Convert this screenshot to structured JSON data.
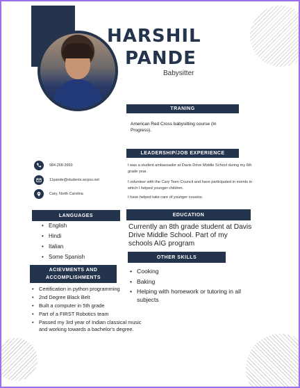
{
  "header": {
    "first_name": "HARSHIL",
    "last_name": "PANDE",
    "role": "Babysitter"
  },
  "training": {
    "title": "TRANING",
    "text": "American Red Cross babysitting course (In Progress)."
  },
  "experience": {
    "title": "LEADERSHIP/JOB EXPERIENCE",
    "items": [
      "I was a student ambassador at Davis Drive Middle School during my 6th grade year.",
      "I volunteer with the Cary Teen Council and have participated in events in which I helped younger children.",
      "I have helped take care of younger cousins."
    ]
  },
  "contact": {
    "phone": "984-268-3993",
    "email": "11pande@students.wcpss.net",
    "location": "Cary, North Carolina"
  },
  "languages": {
    "title": "LANGUAGES",
    "items": [
      "English",
      "Hindi",
      "Italian",
      "Some Spanish"
    ]
  },
  "education": {
    "title": "EDUCATION",
    "text": "Currently an 8th grade student at Davis Drive Middle School. Part of my schools AIG program"
  },
  "achievements": {
    "title_line1": "ACIEVMENTS AND",
    "title_line2": "ACCOMPLISHMENTS",
    "items": [
      "Certification in python programming",
      "2nd Degree Black Belt",
      "Built a computer in 5th grade",
      "Part of a FIRST Robotics team",
      "Passed my 3rd year of Indian classical music and working towards a bachelor's degree."
    ]
  },
  "skills": {
    "title": "OTHER SKILLS",
    "items": [
      "Cooking",
      "Baking",
      "Helping with homework or tutoring in all subjects"
    ]
  },
  "colors": {
    "navy": "#24344d",
    "frame": "#9b6ff2"
  },
  "icons": [
    "phone-icon",
    "mail-icon",
    "location-pin-icon"
  ]
}
